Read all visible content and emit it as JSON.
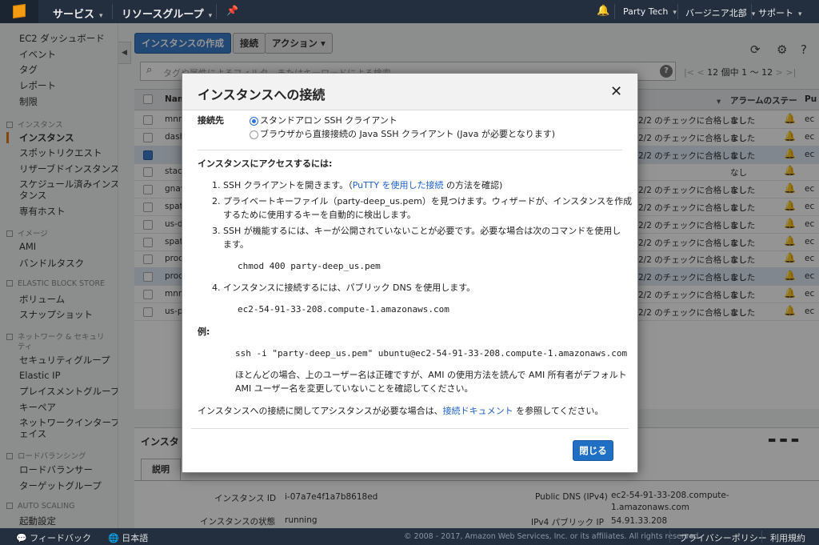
{
  "topnav": {
    "services": "サービス",
    "resource_groups": "リソースグループ",
    "account": "Party Tech",
    "region": "バージニア北部",
    "support": "サポート"
  },
  "sidebar": {
    "items_top": [
      "EC2 ダッシュボード",
      "イベント",
      "タグ",
      "レポート",
      "制限"
    ],
    "sections": {
      "instances": {
        "title": "インスタンス",
        "items": [
          "インスタンス",
          "スポットリクエスト",
          "リザーブドインスタンス",
          "スケジュール済みインス",
          "タンス",
          "専有ホスト"
        ]
      },
      "images": {
        "title": "イメージ",
        "items": [
          "AMI",
          "バンドルタスク"
        ]
      },
      "ebs": {
        "title": "ELASTIC BLOCK STORE",
        "items": [
          "ボリューム",
          "スナップショット"
        ]
      },
      "network": {
        "title_1": "ネットワーク & セキュリ",
        "title_2": "ティ",
        "items": [
          "セキュリティグループ",
          "Elastic IP",
          "プレイスメントグループ",
          "キーペア",
          "ネットワークインターフ",
          "ェイス"
        ]
      },
      "lb": {
        "title": "ロードバランシング",
        "items": [
          "ロードバランサー",
          "ターゲットグループ"
        ]
      },
      "autoscaling": {
        "title": "AUTO SCALING",
        "items": [
          "起動設定"
        ]
      }
    }
  },
  "toolbar": {
    "launch": "インスタンスの作成",
    "connect": "接続",
    "actions": "アクション"
  },
  "search": {
    "placeholder": "タグや属性によるフィルタ、またはキーワードによる検索"
  },
  "pager": {
    "text": "12 個中 1 〜 12"
  },
  "table": {
    "headers": {
      "name": "Nam",
      "alarm": "アラームのステー",
      "pub": "Pu"
    },
    "rows": [
      {
        "name": "mnm",
        "status": "2/2 のチェックに合格しました",
        "alarm": "なし",
        "pub": "ec"
      },
      {
        "name": "dash",
        "status": "2/2 のチェックに合格しました",
        "alarm": "なし",
        "pub": "ec"
      },
      {
        "name": "",
        "status": "2/2 のチェックに合格しました",
        "alarm": "なし",
        "pub": "ec"
      },
      {
        "name": "stac",
        "status": "",
        "alarm": "なし",
        "pub": ""
      },
      {
        "name": "gnav",
        "status": "2/2 のチェックに合格しました",
        "alarm": "なし",
        "pub": "ec"
      },
      {
        "name": "spat",
        "status": "2/2 のチェックに合格しました",
        "alarm": "なし",
        "pub": "ec"
      },
      {
        "name": "us-d",
        "status": "2/2 のチェックに合格しました",
        "alarm": "なし",
        "pub": "ec"
      },
      {
        "name": "spat",
        "status": "2/2 のチェックに合格しました",
        "alarm": "なし",
        "pub": "ec"
      },
      {
        "name": "prod",
        "status": "2/2 のチェックに合格しました",
        "alarm": "なし",
        "pub": "ec"
      },
      {
        "name": "prod",
        "status": "2/2 のチェックに合格しました",
        "alarm": "なし",
        "pub": "ec"
      },
      {
        "name": "mnm",
        "status": "2/2 のチェックに合格しました",
        "alarm": "なし",
        "pub": "ec"
      },
      {
        "name": "us-p",
        "status": "2/2 のチェックに合格しました",
        "alarm": "なし",
        "pub": "ec"
      }
    ]
  },
  "detail": {
    "title": "インスタ",
    "tab": "説明",
    "instance_id_label": "インスタンス ID",
    "instance_id": "i-07a7e4f1a7b8618ed",
    "state_label": "インスタンスの状態",
    "state": "running",
    "dns_label": "Public DNS (IPv4)",
    "dns_1": "ec2-54-91-33-208.compute-",
    "dns_2": "1.amazonaws.com",
    "ip_label": "IPv4 パブリック IP",
    "ip": "54.91.33.208"
  },
  "footer": {
    "feedback": "フィードバック",
    "language": "日本語",
    "copyright": "© 2008 - 2017, Amazon Web Services, Inc. or its affiliates. All rights reserved.",
    "privacy": "プライバシーポリシー",
    "terms": "利用規約"
  },
  "modal": {
    "title": "インスタンスへの接続",
    "connect_label": "接続先",
    "option_standalone": "スタンドアロン SSH クライアント",
    "option_browser": "ブラウザから直接接続の Java SSH クライアント (Java が必要となります)",
    "access_heading": "インスタンスにアクセスするには:",
    "step1_pre": "1. SSH クライアントを開きます。（",
    "step1_link": "PuTTY を使用した接続",
    "step1_post": " の方法を確認)",
    "step2_line1": "2. プライベートキーファイル（party-deep_us.pem）を見つけます。ウィザードが、インスタンスを作成",
    "step2_line2": "するために使用するキーを自動的に検出します。",
    "step3_line1": "3. SSH が機能するには、キーが公開されていないことが必要です。必要な場合は次のコマンドを使用し",
    "step3_line2": "ます。",
    "chmod_cmd": "chmod 400 party-deep_us.pem",
    "step4": "4. インスタンスに接続するには、パブリック DNS を使用します。",
    "dns": "ec2-54-91-33-208.compute-1.amazonaws.com",
    "example_label": "例:",
    "ssh_cmd": "ssh -i \"party-deep_us.pem\" ubuntu@ec2-54-91-33-208.compute-1.amazonaws.com",
    "note_line1": "ほとんどの場合、上のユーザー名は正確ですが、AMI の使用方法を読んで AMI 所有者がデフォルト",
    "note_line2": "AMI ユーザー名を変更していないことを確認してください。",
    "assist_pre": "インスタンスへの接続に関してアシスタンスが必要な場合は、",
    "assist_link": "接続ドキュメント",
    "assist_post": " を参照してください。",
    "close_button": "閉じる"
  }
}
